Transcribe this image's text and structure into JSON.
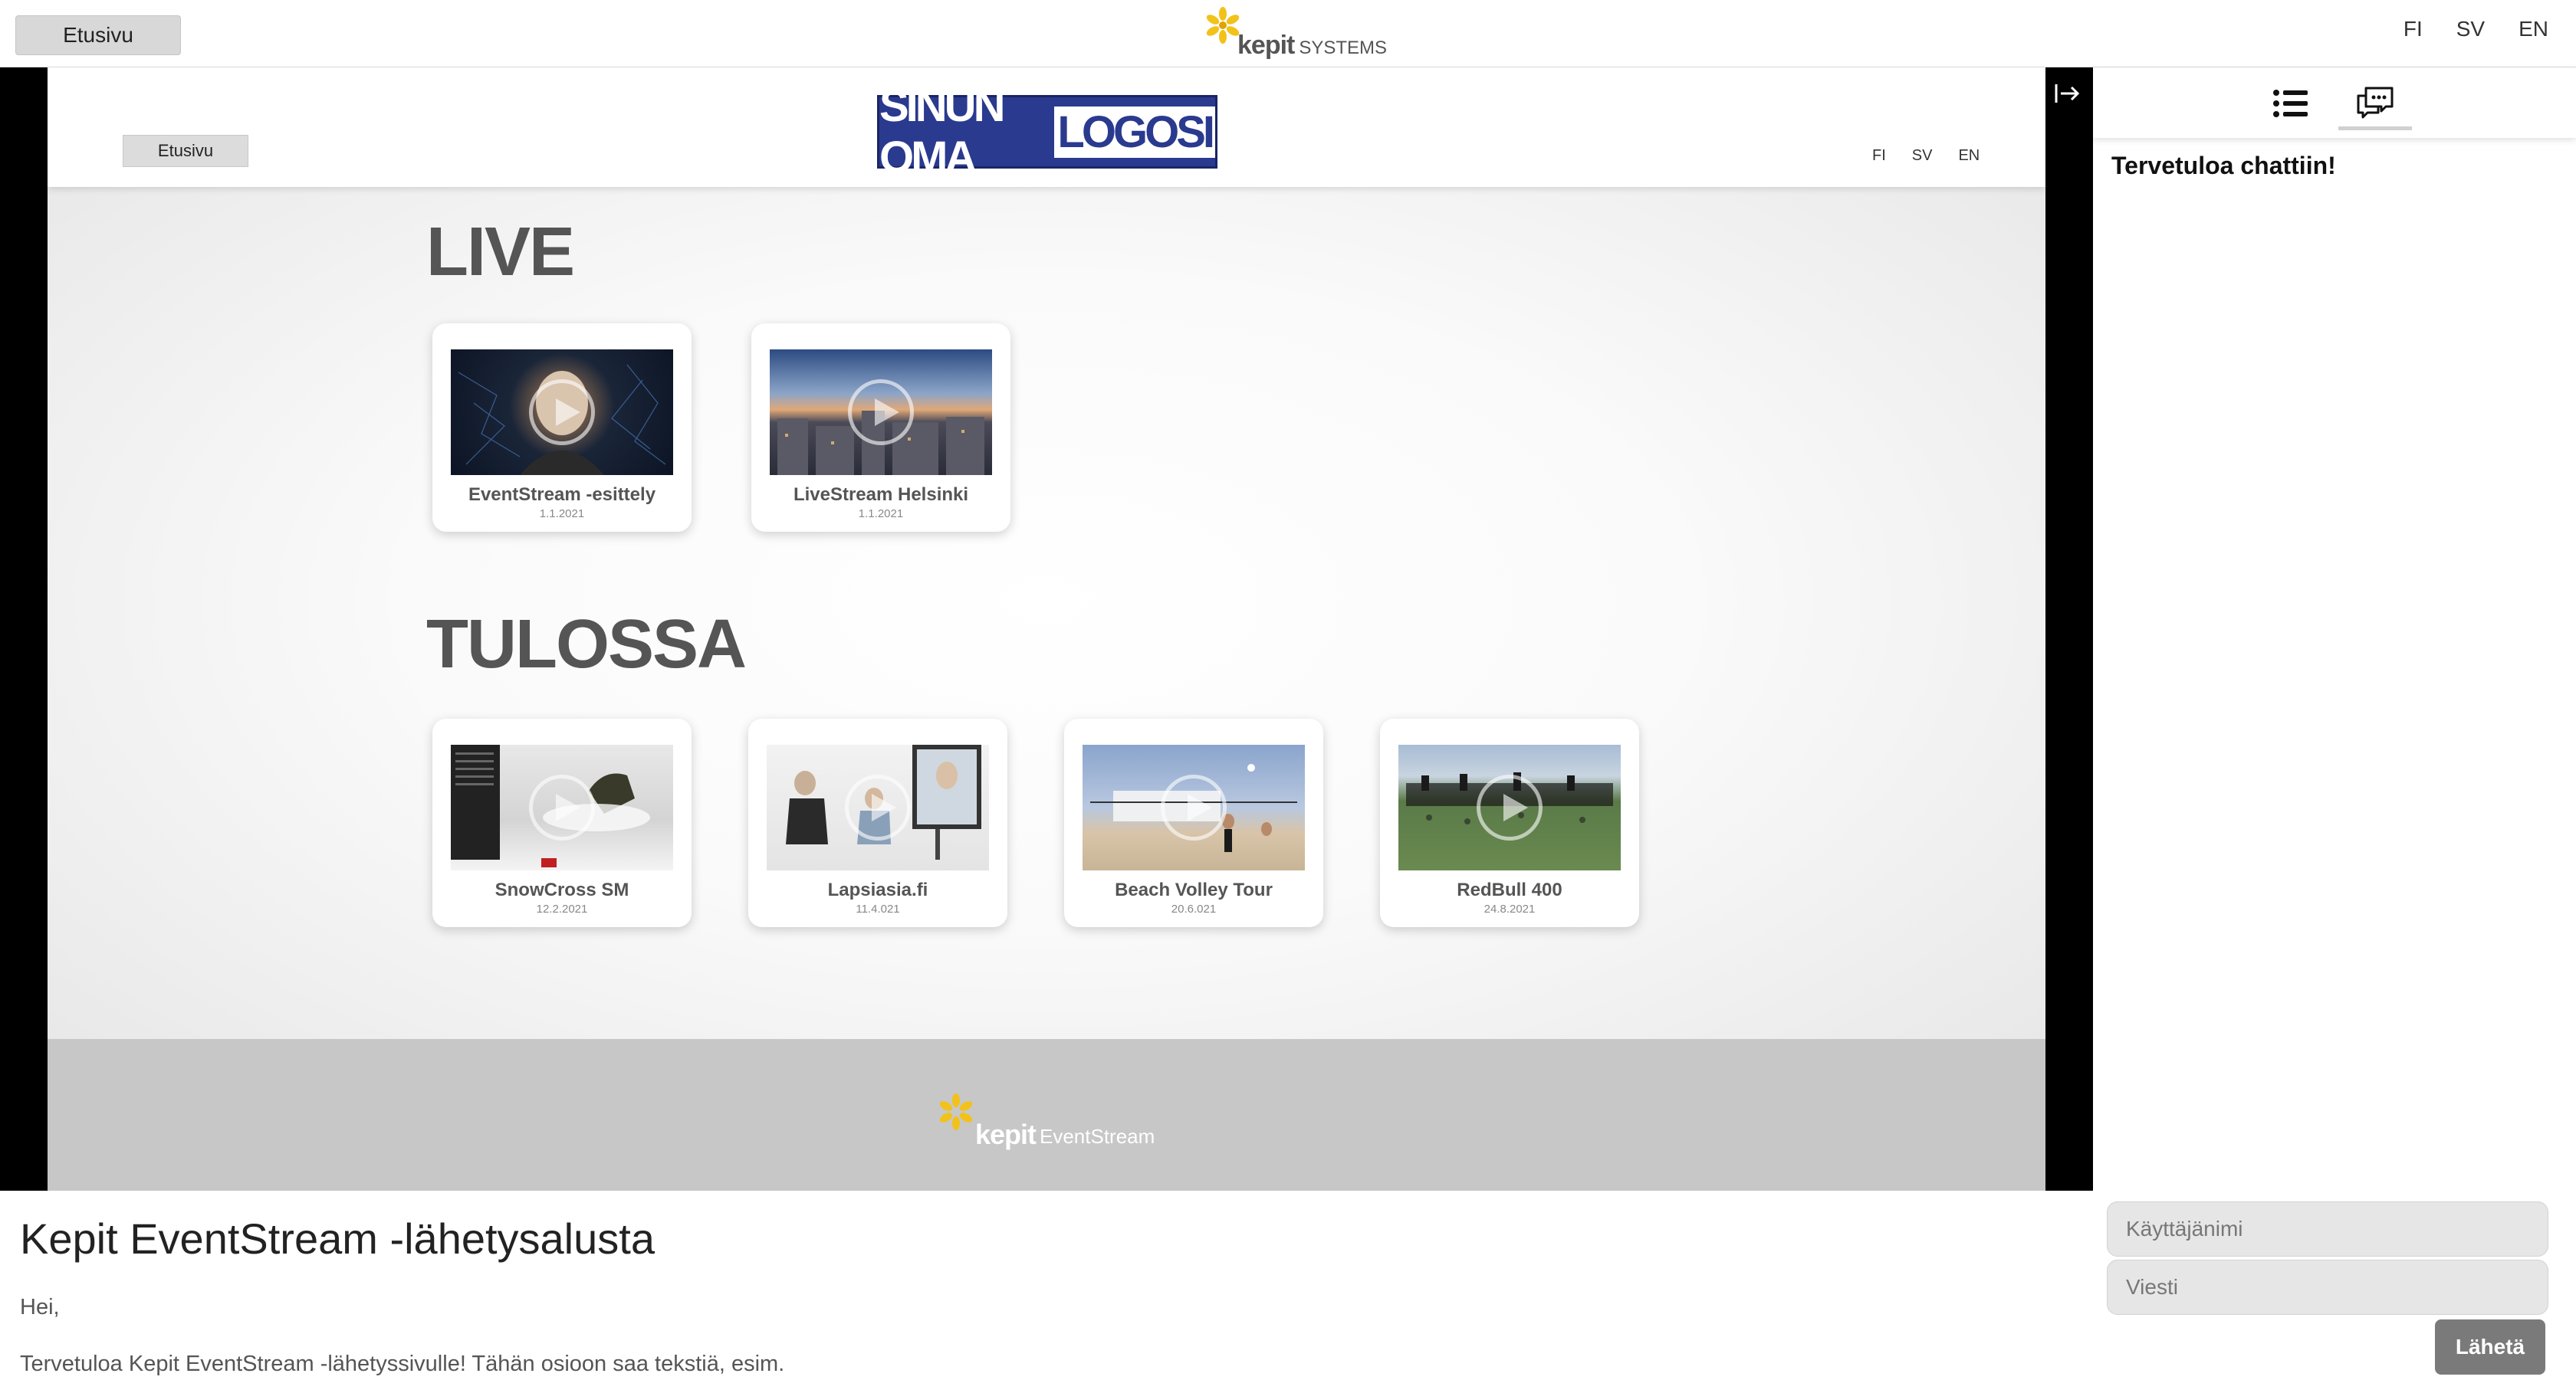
{
  "topbar": {
    "home_label": "Etusivu",
    "brand_name": "kepit",
    "brand_sub": "SYSTEMS",
    "languages": [
      "FI",
      "SV",
      "EN"
    ]
  },
  "stream": {
    "home_label": "Etusivu",
    "logo_part1": "SINUN OMA",
    "logo_part2": "LOGOSI",
    "languages": [
      "FI",
      "SV",
      "EN"
    ],
    "live_title": "LIVE",
    "live": [
      {
        "title": "EventStream -esittely",
        "date": "1.1.2021"
      },
      {
        "title": "LiveStream Helsinki",
        "date": "1.1.2021"
      }
    ],
    "upcoming_title": "TULOSSA",
    "upcoming": [
      {
        "title": "SnowCross SM",
        "date": "12.2.2021"
      },
      {
        "title": "Lapsiasia.fi",
        "date": "11.4.021"
      },
      {
        "title": "Beach Volley Tour",
        "date": "20.6.021"
      },
      {
        "title": "RedBull 400",
        "date": "24.8.2021"
      }
    ],
    "footer_name": "kepit",
    "footer_sub": "EventStream"
  },
  "chat": {
    "welcome": "Tervetuloa chattiin!",
    "username_placeholder": "Käyttäjänimi",
    "message_placeholder": "Viesti",
    "send_label": "Lähetä"
  },
  "description": {
    "title": "Kepit EventStream -lähetysalusta",
    "greeting": "Hei,",
    "body": "Tervetuloa Kepit EventStream -lähetyssivulle! Tähän osioon saa tekstiä, esim."
  },
  "colors": {
    "logo_blue": "#2a3a8f",
    "send_button": "#7a7a7a",
    "brand_yellow": "#f2c21a"
  }
}
